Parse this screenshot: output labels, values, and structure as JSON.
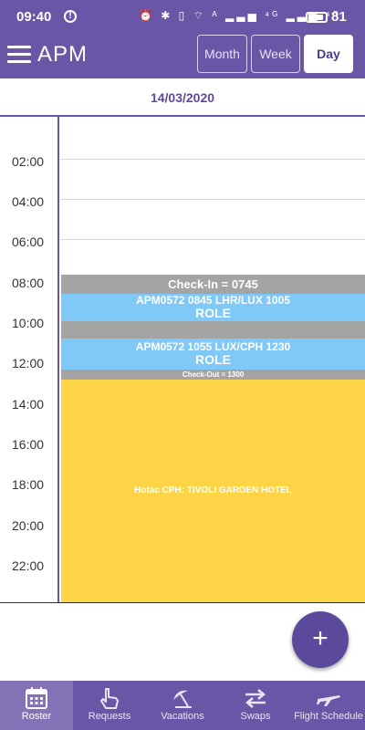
{
  "status_bar": {
    "time": "09:40",
    "alert_icon": "!",
    "icons_text": "⏰ ✱ ▯ ⌔ ᴬ ▂▃▅ ⁴ᴳ ▂▃▅ ⁴ᴳ",
    "battery": "81"
  },
  "app": {
    "title": "APM",
    "views": {
      "month": "Month",
      "week": "Week",
      "day": "Day"
    },
    "selected_view": "Day"
  },
  "date": "14/03/2020",
  "time_labels": [
    "02:00",
    "04:00",
    "06:00",
    "08:00",
    "10:00",
    "12:00",
    "14:00",
    "16:00",
    "18:00",
    "20:00",
    "22:00"
  ],
  "events": [
    {
      "title": "Check-In = 0745",
      "type": "duty"
    },
    {
      "title": "APM0572 0845 LHR/LUX 1005",
      "subtitle": "ROLE",
      "type": "flight"
    },
    {
      "title": "APM0572 1055 LUX/CPH 1230",
      "subtitle": "ROLE",
      "type": "flight"
    },
    {
      "title": "Check-Out = 1300",
      "type": "duty"
    },
    {
      "title": "Hotac CPH: TIVOLI GARDEN HOTEL",
      "type": "hotel"
    }
  ],
  "colors": {
    "primary": "#6a56a6",
    "duty": "#a4a4a4",
    "flight": "#7fc8f8",
    "hotel": "#fdd446"
  },
  "fab_label": "+",
  "bottom_nav": [
    {
      "label": "Roster",
      "icon": "calendar-icon",
      "active": true
    },
    {
      "label": "Requests",
      "icon": "hand-pointer-icon",
      "active": false
    },
    {
      "label": "Vacations",
      "icon": "umbrella-icon",
      "active": false
    },
    {
      "label": "Swaps",
      "icon": "swap-arrows-icon",
      "active": false
    },
    {
      "label": "Flight Schedule",
      "icon": "airplane-icon",
      "active": false
    }
  ]
}
